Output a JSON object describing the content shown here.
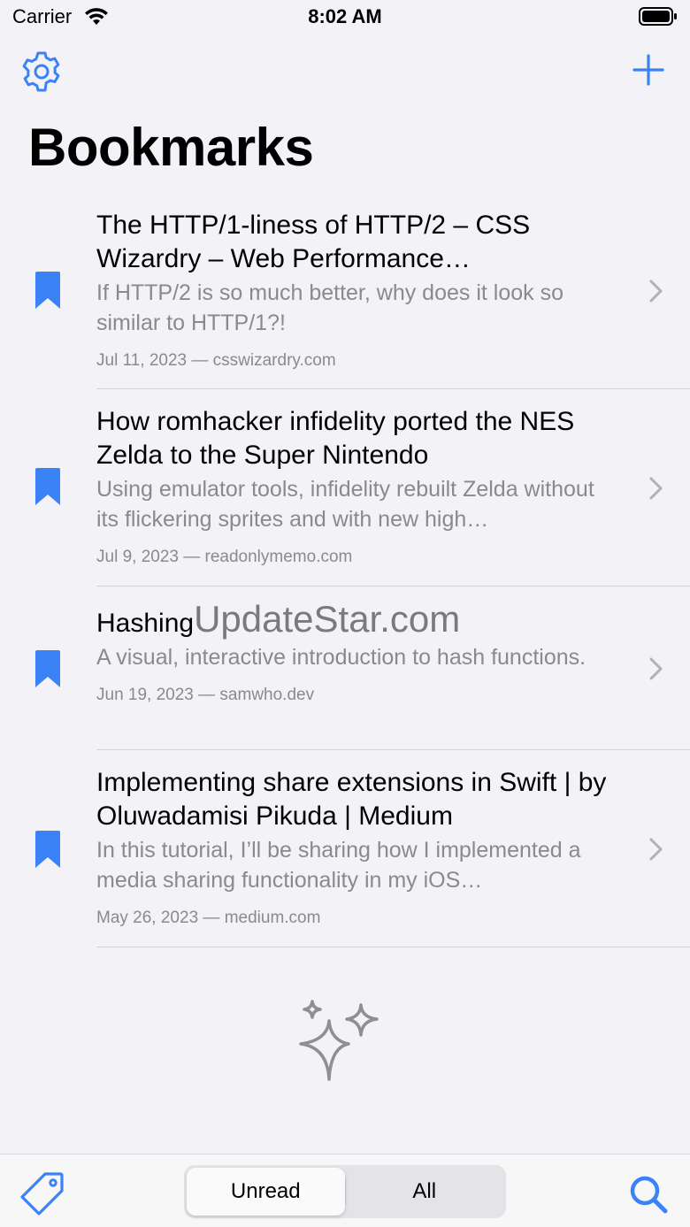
{
  "status": {
    "carrier": "Carrier",
    "time": "8:02 AM"
  },
  "header": {
    "title": "Bookmarks"
  },
  "bookmarks": [
    {
      "title": "The HTTP/1-liness of HTTP/2 – CSS Wizardry – Web Performance…",
      "description": "If HTTP/2 is so much better, why does it look so similar to HTTP/1?!",
      "meta": "Jul 11, 2023 — csswizardry.com"
    },
    {
      "title": "How romhacker infidelity ported the NES Zelda to the Super Nintendo",
      "description": "Using emulator tools, infidelity rebuilt Zelda without its flickering sprites and with new high…",
      "meta": "Jul 9, 2023 — readonlymemo.com"
    },
    {
      "title": "Hashing",
      "watermark": "UpdateStar.com",
      "description": "A visual, interactive introduction to hash functions.",
      "meta": "Jun 19, 2023 — samwho.dev"
    },
    {
      "title": "Implementing share extensions in Swift | by Oluwadamisi Pikuda | Medium",
      "description": "In this tutorial, I’ll be sharing how I implemented a media sharing functionality in my iOS…",
      "meta": "May 26, 2023 — medium.com"
    }
  ],
  "toolbar": {
    "segments": [
      "Unread",
      "All"
    ],
    "selected": "Unread"
  },
  "colors": {
    "accent": "#3b82f6",
    "secondary_text": "#8a8a8e",
    "icon_gray": "#8e8e93"
  }
}
